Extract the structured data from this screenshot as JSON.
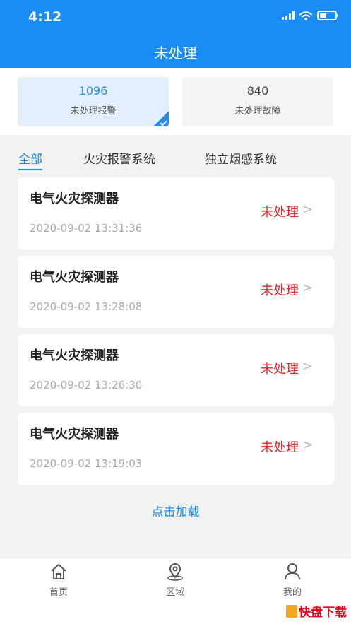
{
  "status_bar": {
    "time": "4:12"
  },
  "header": {
    "title": "未处理"
  },
  "stats": [
    {
      "number": "1096",
      "label": "未处理报警"
    },
    {
      "number": "840",
      "label": "未处理故障"
    }
  ],
  "tabs": [
    "全部",
    "火灾报警系统",
    "独立烟感系统"
  ],
  "alarms": [
    {
      "title": "电气火灾探测器",
      "time": "2020-09-02 13:31:36",
      "status": "未处理"
    },
    {
      "title": "电气火灾探测器",
      "time": "2020-09-02 13:28:08",
      "status": "未处理"
    },
    {
      "title": "电气火灾探测器",
      "time": "2020-09-02 13:26:30",
      "status": "未处理"
    },
    {
      "title": "电气火灾探测器",
      "time": "2020-09-02 13:19:03",
      "status": "未处理"
    }
  ],
  "chevron": ">",
  "load_more": "点击加载",
  "bottom_nav": [
    {
      "label": "首页",
      "icon": "home-icon"
    },
    {
      "label": "区域",
      "icon": "location-icon"
    },
    {
      "label": "我的",
      "icon": "user-icon"
    }
  ],
  "watermark": {
    "text": "快盘下载"
  },
  "colors": {
    "primary": "#1a8cf5",
    "alert": "#e8202a"
  }
}
